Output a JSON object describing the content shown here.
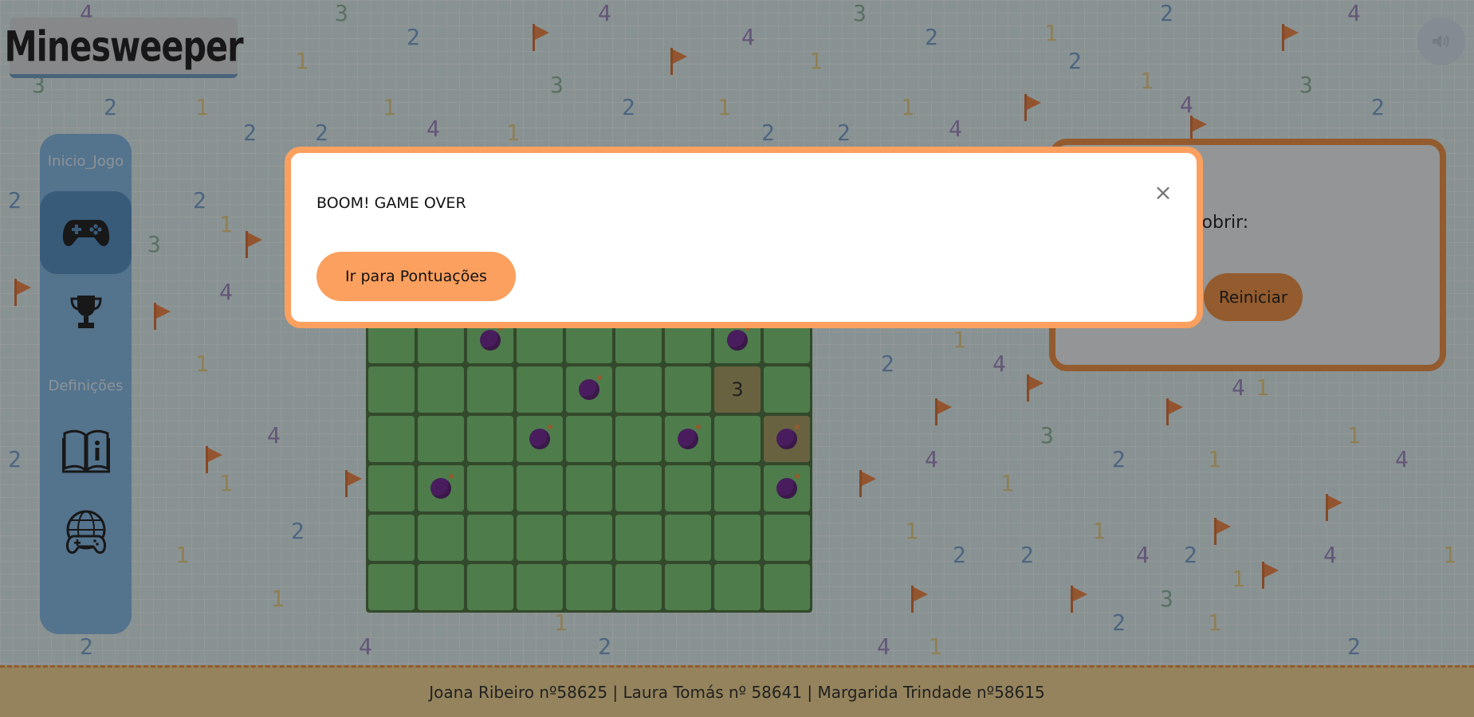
{
  "app": {
    "title": "Minesweeper"
  },
  "sound": {
    "icon": "speaker-icon"
  },
  "sidebar": {
    "section_game": "Inicio_Jogo",
    "section_settings": "Definições",
    "items": [
      {
        "icon": "gamepad-icon",
        "active": true
      },
      {
        "icon": "trophy-icon",
        "active": false
      },
      {
        "icon": "book-info-icon",
        "active": false
      },
      {
        "icon": "globe-gamepad-icon",
        "active": false
      }
    ]
  },
  "board": {
    "columns": 9,
    "rows": [
      [
        "",
        "",
        "bomb",
        "",
        "",
        "",
        "",
        "bomb",
        ""
      ],
      [
        "",
        "",
        "",
        "",
        "bomb",
        "",
        "",
        "3",
        ""
      ],
      [
        "",
        "",
        "",
        "bomb",
        "",
        "",
        "bomb",
        "",
        "bomb"
      ],
      [
        "",
        "bomb",
        "",
        "",
        "",
        "",
        "",
        "",
        "bomb"
      ],
      [
        "",
        "",
        "",
        "",
        "",
        "",
        "",
        "",
        ""
      ],
      [
        "",
        "",
        "",
        "",
        "",
        "",
        "",
        "",
        ""
      ]
    ],
    "revealed": [
      [
        1,
        7
      ],
      [
        2,
        8
      ]
    ]
  },
  "info_panel": {
    "text": "scobrir:",
    "restart_label": "Reiniciar"
  },
  "modal": {
    "title": "BOOM! GAME OVER",
    "close_label": "×",
    "button_label": "Ir para Pontuações"
  },
  "footer": {
    "text": "Joana Ribeiro nº58625 | Laura Tomás nº 58641 | Margarida Trindade nº58615"
  },
  "colors": {
    "accent": "#fba05f",
    "sidebar": "#7fb6e6",
    "cell": "#73c66e",
    "bomb": "#6a1a8f"
  }
}
